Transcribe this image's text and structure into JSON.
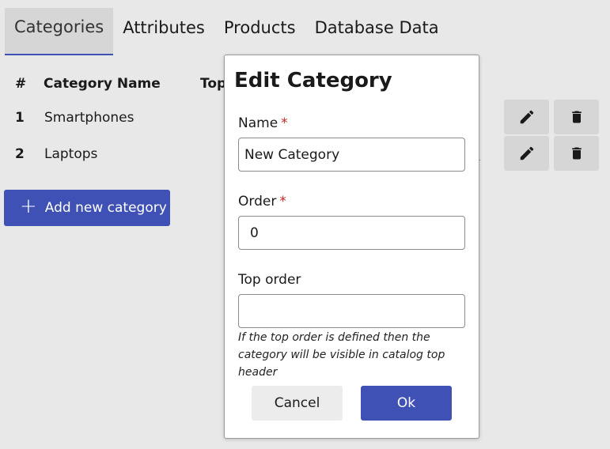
{
  "tabs": [
    {
      "label": "Categories",
      "active": true
    },
    {
      "label": "Attributes",
      "active": false
    },
    {
      "label": "Products",
      "active": false
    },
    {
      "label": "Database Data",
      "active": false
    }
  ],
  "table": {
    "headers": {
      "num": "#",
      "name": "Category Name",
      "top": "Top"
    },
    "rows": [
      {
        "num": "1",
        "name": "Smartphones"
      },
      {
        "num": "2",
        "name": "Laptops"
      }
    ],
    "partial_link": ")"
  },
  "row_actions": {
    "edit_icon": "pencil-icon",
    "delete_icon": "trash-icon"
  },
  "add_button": {
    "label": "Add new category",
    "icon": "plus-icon"
  },
  "dialog": {
    "title": "Edit Category",
    "name": {
      "label": "Name",
      "required_mark": "*",
      "value": "New Category"
    },
    "order": {
      "label": "Order",
      "required_mark": "*",
      "value": "0"
    },
    "top_order": {
      "label": "Top order",
      "value": ""
    },
    "help_text": "If the top order is defined then the category will be visible in catalog top header",
    "cancel_label": "Cancel",
    "ok_label": "Ok"
  },
  "colors": {
    "accent": "#3f51b5",
    "required": "#c62828",
    "background": "#e8e8e8",
    "button_gray": "#d6d6d6"
  }
}
